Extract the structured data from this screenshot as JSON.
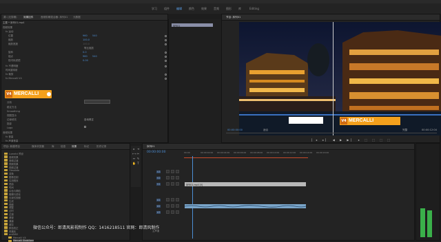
{
  "menu": {
    "items": [
      "文件",
      "编辑",
      "剪辑",
      "序列",
      "标记",
      "图形",
      "视图",
      "窗口",
      "帮助"
    ],
    "center": "Adobe Premiere Pro"
  },
  "workspace": {
    "tabs": [
      "学习",
      "组件",
      "编辑",
      "颜色",
      "效果",
      "音频",
      "图形",
      "库",
      "Editing"
    ]
  },
  "effect_controls": {
    "tabs": [
      "源: (无剪辑)",
      "效果控件",
      "音频剪辑混合器: 序列01",
      "元数据"
    ],
    "clip": "主要 * 序列01.mp4",
    "section": "视频效果",
    "rows": [
      "fx 运动",
      "位置",
      "缩放",
      "缩放宽度",
      "旋转",
      "锚点",
      "防闪烁滤镜",
      "fx 不透明度",
      "时间重映射",
      "fx 裁剪",
      "fx Mercalli V4"
    ],
    "values": [
      "960",
      "540",
      "100.0",
      "100.0",
      "0.0",
      "960",
      "540",
      "0.00"
    ],
    "uniform_scale": "等比缩放",
    "logo_text": "MERCALLI",
    "logo_badge": "V4",
    "more_rows": [
      "分析",
      "稳定方法",
      "Smoothing",
      "视图显示",
      "边缘填充",
      "投影",
      "Logo"
    ],
    "more_values": [
      "自动修正"
    ],
    "footer": "00:00:02:14",
    "audio": "音频效果",
    "audio_rows": [
      "fx 音量",
      "fx 声道音量",
      "fx 声像器"
    ]
  },
  "timeline_header": {
    "label": "序列01",
    "tc": "00:00:00:00"
  },
  "program": {
    "title": "节目: 序列01",
    "left_tc": "00:00:00:00",
    "right_tc": "00:00:12:04",
    "fit": "适合",
    "quality": "完整",
    "sign_text": "MERCALLI",
    "badge": "V4"
  },
  "project": {
    "tabs": [
      "项目: 新建项目",
      "媒体浏览器",
      "库",
      "信息",
      "效果",
      "标记",
      "历史记录"
    ],
    "items": [
      "Lumetri 预设",
      "音频效果",
      "音频过渡",
      "视频效果",
      "视频过渡",
      "Obsolete",
      "变换",
      "图像控制",
      "实用程序",
      "扭曲",
      "时间",
      "杂色与颗粒",
      "模糊与锐化",
      "沉浸式视频",
      "生成",
      "视频",
      "调整",
      "过时",
      "过渡",
      "透视",
      "通道",
      "键控",
      "颜色校正",
      "风格化",
      "proDAD",
      "Mercalli V4",
      "Mercalli Stabilizer"
    ]
  },
  "sequence": {
    "tab": "序列01",
    "tc": "00:00:00:00",
    "tracks": [
      "V3",
      "V2",
      "V1",
      "A1",
      "A2",
      "A3"
    ],
    "clip_label": "序列01.mp4 [V]",
    "master": "主声道",
    "ruler": [
      "00:00",
      "00:00:02:00",
      "00:00:04:00",
      "00:00:06:00",
      "00:00:08:00",
      "00:00:10:00",
      "00:00:12:00",
      "00:00:14:00",
      "00:00:16:00"
    ]
  },
  "watermark": "微信公众号：郎清风影视制作    QQ：1416218511    官网：郎清风制作",
  "audio_meter": {
    "levels": [
      0.32,
      0.3
    ]
  }
}
